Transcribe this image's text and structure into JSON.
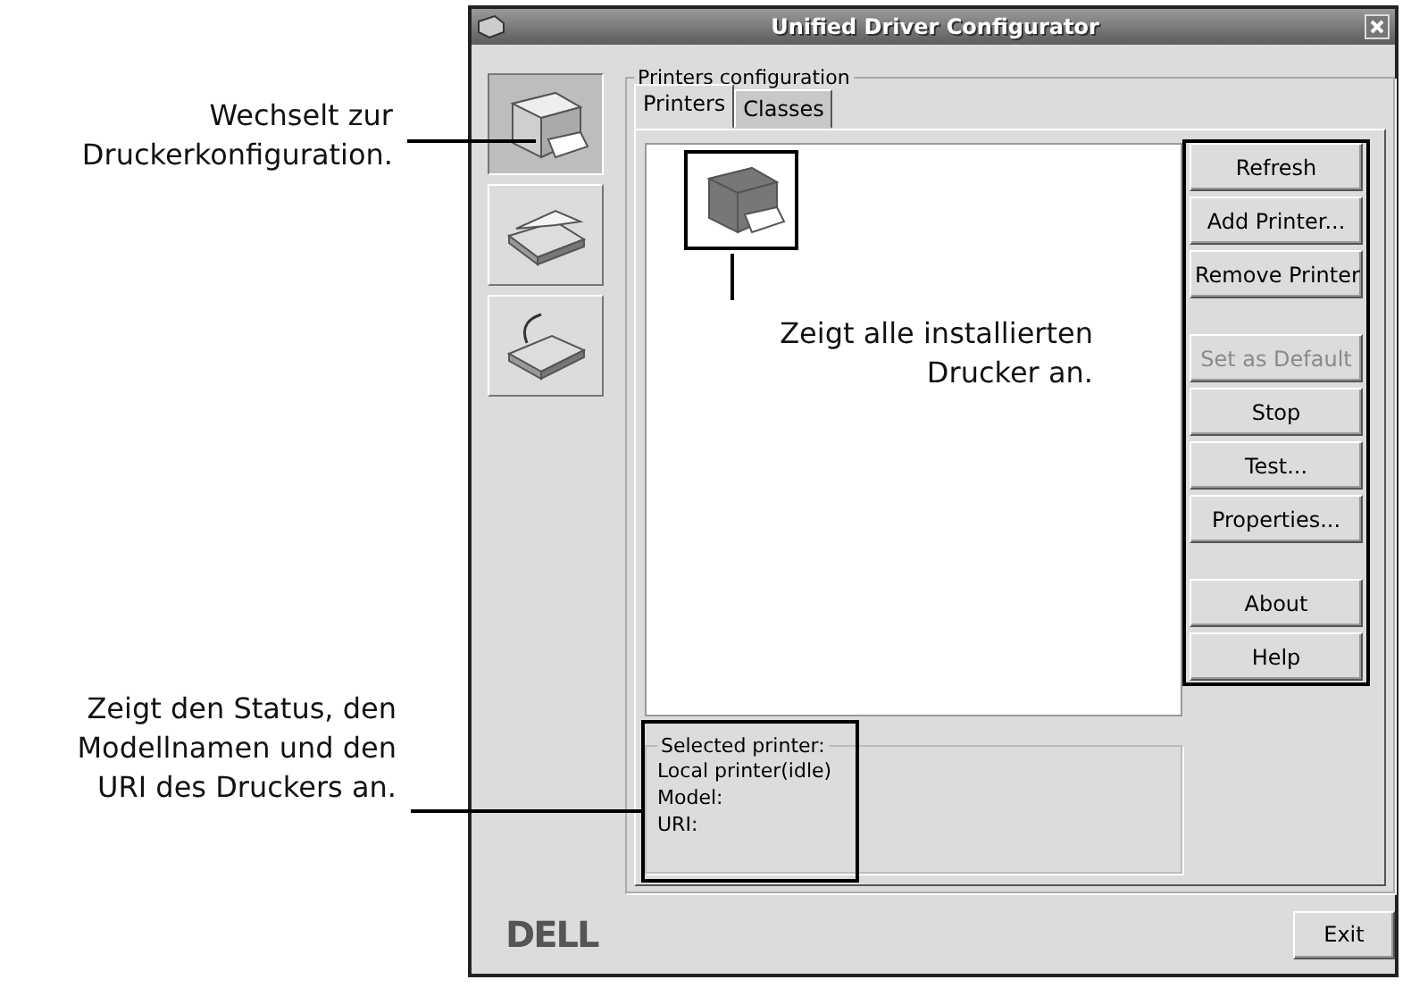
{
  "annotations": [
    {
      "text": "Wechselt zur Druckerkonfiguration."
    },
    {
      "text": "Zeigt alle installierten Drucker an."
    },
    {
      "text": "Zeigt den Status, den Modellnamen und den URI des Druckers an."
    }
  ],
  "window": {
    "title": "Unified Driver Configurator"
  },
  "sidebar": {
    "items": [
      {
        "kind": "printer",
        "selected": true
      },
      {
        "kind": "scanner",
        "selected": false
      },
      {
        "kind": "port",
        "selected": false
      }
    ]
  },
  "group_title": "Printers configuration",
  "tabs": [
    {
      "label": "Printers",
      "selected": true
    },
    {
      "label": "Classes",
      "selected": false
    }
  ],
  "printer_list": {
    "items": [
      {
        "kind": "printer"
      }
    ]
  },
  "button_groups": [
    [
      {
        "label": "Refresh",
        "disabled": false
      },
      {
        "label": "Add Printer...",
        "disabled": false
      },
      {
        "label": "Remove Printer",
        "disabled": false
      }
    ],
    [
      {
        "label": "Set as Default",
        "disabled": true
      },
      {
        "label": "Stop",
        "disabled": false
      },
      {
        "label": "Test...",
        "disabled": false
      },
      {
        "label": "Properties...",
        "disabled": false
      }
    ],
    [
      {
        "label": "About",
        "disabled": false
      },
      {
        "label": "Help",
        "disabled": false
      }
    ]
  ],
  "selected_printer": {
    "title": "Selected printer:",
    "lines": [
      "Local printer(idle)",
      "Model:",
      "URI:"
    ]
  },
  "logo": "DELL",
  "exit_button": "Exit"
}
